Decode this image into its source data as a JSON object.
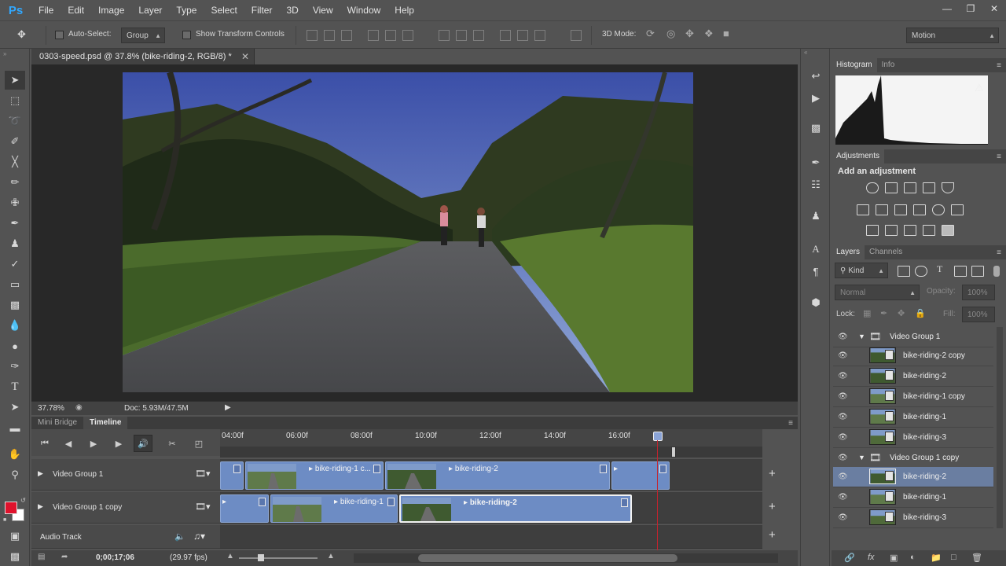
{
  "app": {
    "logo": "Ps"
  },
  "menu": [
    "File",
    "Edit",
    "Image",
    "Layer",
    "Type",
    "Select",
    "Filter",
    "3D",
    "View",
    "Window",
    "Help"
  ],
  "window_controls": [
    "minimize-icon",
    "restore-icon",
    "close-icon"
  ],
  "options": {
    "auto_select_label": "Auto-Select:",
    "auto_select_value": "Group",
    "show_transform_label": "Show Transform Controls",
    "mode_3d_label": "3D Mode:",
    "workspace": "Motion"
  },
  "document": {
    "tab_title": "0303-speed.psd @ 37.8% (bike-riding-2, RGB/8) *",
    "zoom": "37.78%",
    "doc_info": "Doc: 5.93M/47.5M"
  },
  "timeline": {
    "tabs": [
      "Mini Bridge",
      "Timeline"
    ],
    "active_tab": "Timeline",
    "ruler": [
      "04:00f",
      "06:00f",
      "08:00f",
      "10:00f",
      "12:00f",
      "14:00f",
      "16:00f"
    ],
    "tracks": [
      {
        "name": "Video Group 1",
        "clips": [
          "bike-riding-1 c...",
          "bike-riding-2",
          ""
        ]
      },
      {
        "name": "Video Group 1 copy",
        "clips": [
          "",
          "bike-riding-1",
          "bike-riding-2"
        ]
      },
      {
        "name": "Audio Track",
        "clips": []
      }
    ],
    "timecode": "0;00;17;06",
    "fps": "(29.97 fps)"
  },
  "panels": {
    "histogram_tabs": [
      "Histogram",
      "Info"
    ],
    "adjustments_tab": "Adjustments",
    "add_adjustment": "Add an adjustment",
    "layers_tabs": [
      "Layers",
      "Channels"
    ],
    "filter_kind": "Kind",
    "blend_mode": "Normal",
    "opacity_label": "Opacity:",
    "opacity_value": "100%",
    "lock_label": "Lock:",
    "fill_label": "Fill:",
    "fill_value": "100%"
  },
  "layers": [
    {
      "name": "Video Group 1",
      "type": "group",
      "selected": false
    },
    {
      "name": "bike-riding-2 copy",
      "type": "video",
      "selected": false
    },
    {
      "name": "bike-riding-2",
      "type": "video",
      "selected": false
    },
    {
      "name": "bike-riding-1 copy",
      "type": "video",
      "selected": false
    },
    {
      "name": "bike-riding-1",
      "type": "video",
      "selected": false
    },
    {
      "name": "bike-riding-3",
      "type": "video",
      "selected": false
    },
    {
      "name": "Video Group 1 copy",
      "type": "group",
      "selected": false
    },
    {
      "name": "bike-riding-2",
      "type": "video",
      "selected": true
    },
    {
      "name": "bike-riding-1",
      "type": "video",
      "selected": false
    },
    {
      "name": "bike-riding-3",
      "type": "video",
      "selected": false
    }
  ],
  "colors": {
    "foreground": "#e0122c",
    "background": "#ffffff",
    "clip": "#6d8cc4",
    "playhead": "#c4232e",
    "selection": "#6a7ea1"
  }
}
